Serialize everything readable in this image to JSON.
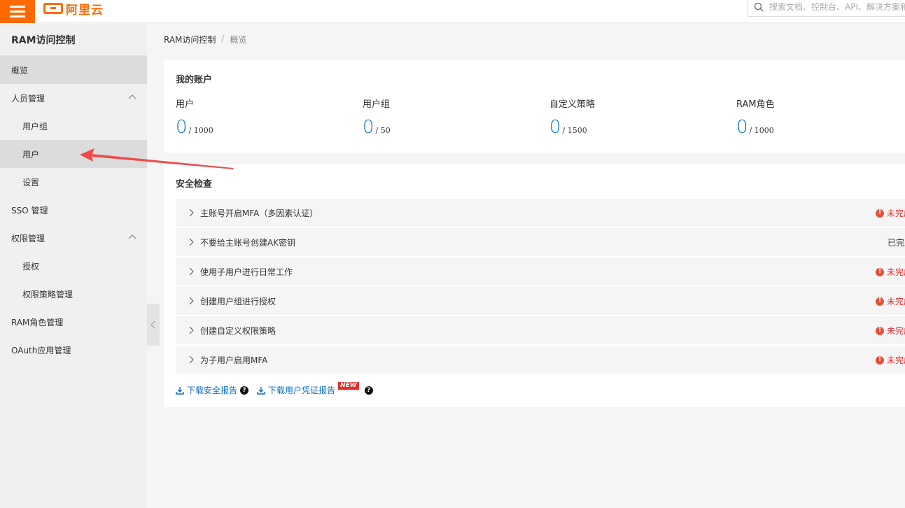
{
  "brand": {
    "logo_text": "阿里云"
  },
  "search": {
    "placeholder": "搜索文档、控制台、API、解决方案和资源"
  },
  "sidebar": {
    "title": "RAM访问控制",
    "items": [
      {
        "label": "概览"
      },
      {
        "label": "人员管理"
      },
      {
        "label": "用户组"
      },
      {
        "label": "用户"
      },
      {
        "label": "设置"
      },
      {
        "label": "SSO 管理"
      },
      {
        "label": "权限管理"
      },
      {
        "label": "授权"
      },
      {
        "label": "权限策略管理"
      },
      {
        "label": "RAM角色管理"
      },
      {
        "label": "OAuth应用管理"
      }
    ]
  },
  "breadcrumb": {
    "root": "RAM访问控制",
    "sep": "/",
    "current": "概览"
  },
  "account": {
    "title": "我的账户",
    "stats": [
      {
        "label": "用户",
        "value": "0",
        "limit": "/ 1000"
      },
      {
        "label": "用户组",
        "value": "0",
        "limit": "/ 50"
      },
      {
        "label": "自定义策略",
        "value": "0",
        "limit": "/ 1500"
      },
      {
        "label": "RAM角色",
        "value": "0",
        "limit": "/ 1000"
      }
    ]
  },
  "security": {
    "title": "安全检查",
    "items": [
      {
        "label": "主账号开启MFA（多因素认证）",
        "status": "未完成",
        "done": false
      },
      {
        "label": "不要给主账号创建AK密钥",
        "status": "已完成",
        "done": true
      },
      {
        "label": "使用子用户进行日常工作",
        "status": "未完成",
        "done": false
      },
      {
        "label": "创建用户组进行授权",
        "status": "未完成",
        "done": false
      },
      {
        "label": "创建自定义权限策略",
        "status": "未完成",
        "done": false
      },
      {
        "label": "为子用户启用MFA",
        "status": "未完成",
        "done": false
      }
    ],
    "download_security_report": "下载安全报告",
    "download_credential_report": "下载用户凭证报告",
    "new_badge": "NEW"
  },
  "colors": {
    "brand": "#ff6a00",
    "link": "#0070cc",
    "danger": "#e62e2e",
    "annotation_arrow": "#f04a4a"
  }
}
